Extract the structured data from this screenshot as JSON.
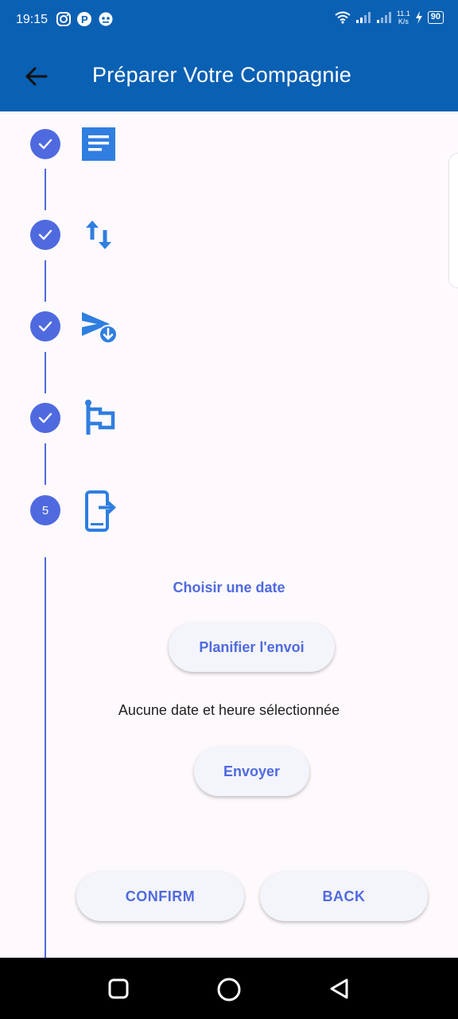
{
  "status_bar": {
    "time": "19:15",
    "left_icons": [
      "instagram-icon",
      "p-icon",
      "bot-icon"
    ],
    "net_speed_value": "11.1",
    "net_speed_unit": "K/s",
    "battery": "90"
  },
  "app_bar": {
    "title": "Préparer Votre Compagnie",
    "back_icon": "arrow-left-icon"
  },
  "stepper": {
    "accent_color": "#4f6adf",
    "steps": [
      {
        "state": "completed",
        "icon": "article-icon"
      },
      {
        "state": "completed",
        "icon": "swap-vertical-icon"
      },
      {
        "state": "completed",
        "icon": "send-download-icon"
      },
      {
        "state": "completed",
        "icon": "flag-icon"
      },
      {
        "state": "active",
        "number": "5",
        "icon": "phone-exit-icon"
      }
    ]
  },
  "schedule": {
    "choose_label": "Choisir une date",
    "plan_button": "Planifier l'envoi",
    "no_date_text": "Aucune date et heure sélectionnée",
    "send_button": "Envoyer"
  },
  "controls": {
    "confirm": "CONFIRM",
    "back": "BACK"
  },
  "colors": {
    "app_bar": "#0a60b3",
    "background": "#fdf9fd",
    "icon_blue": "#2f7ee0"
  }
}
